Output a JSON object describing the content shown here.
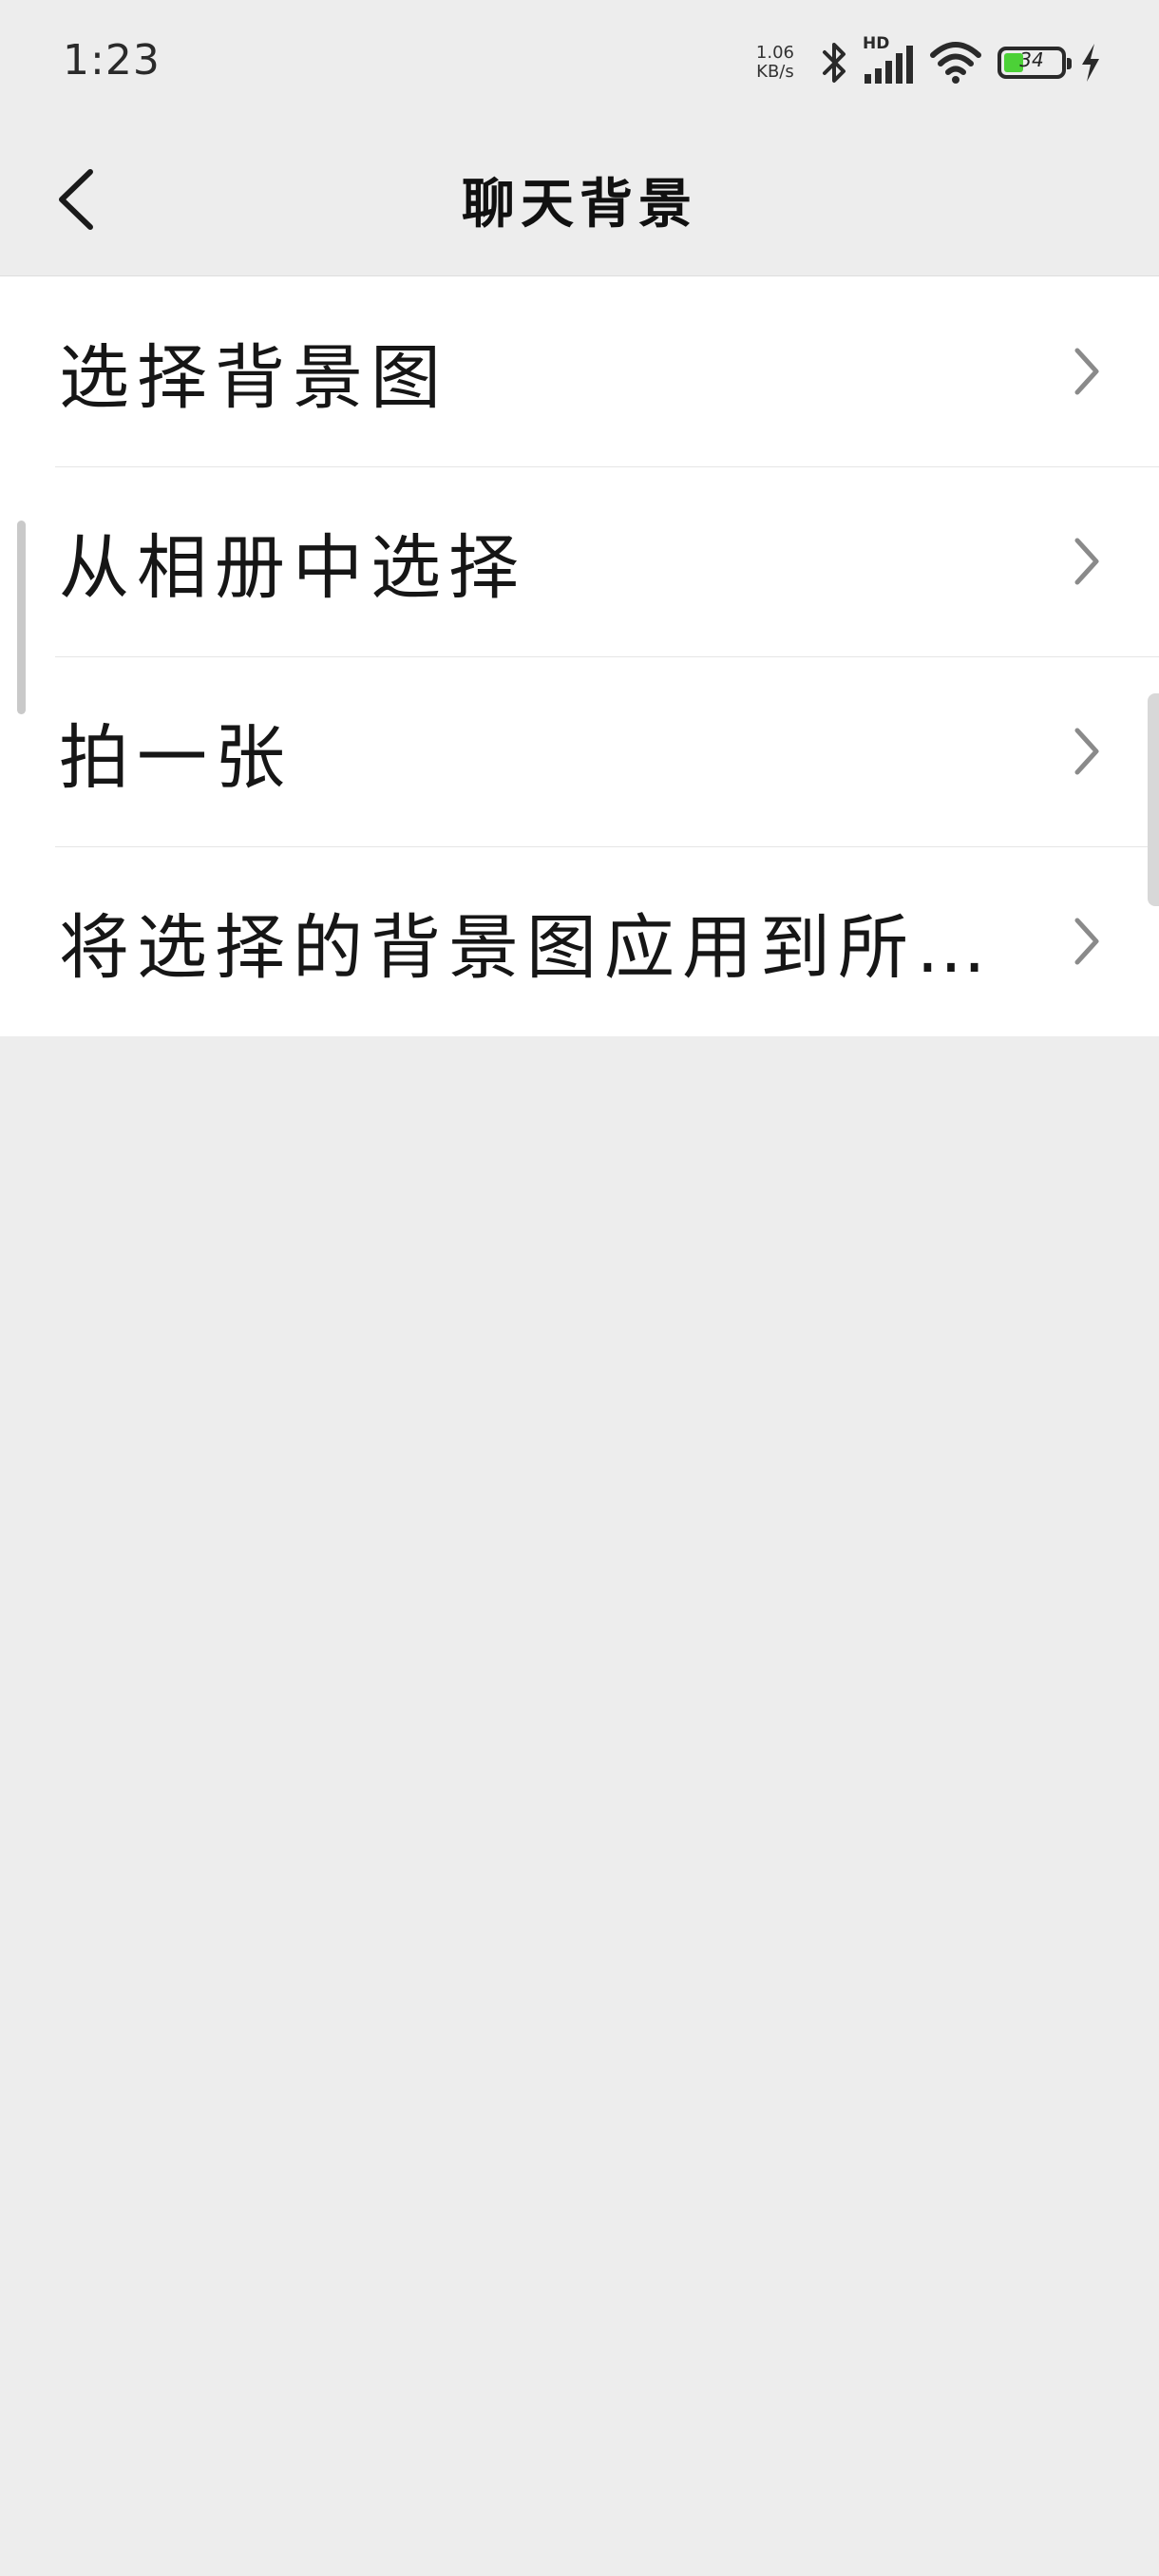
{
  "status_bar": {
    "time": "1:23",
    "net_speed_value": "1.06",
    "net_speed_unit": "KB/s",
    "network_label": "HD",
    "battery_level": "34",
    "battery_fraction": 0.34,
    "battery_color": "#4cd137",
    "icons": [
      "bluetooth-icon",
      "signal-icon",
      "wifi-icon",
      "battery-icon",
      "charging-icon"
    ]
  },
  "header": {
    "title": "聊天背景",
    "back_icon": "back-arrow-icon"
  },
  "menu": {
    "items": [
      {
        "label": "选择背景图"
      },
      {
        "label": "从相册中选择"
      },
      {
        "label": "拍一张"
      },
      {
        "label": "将选择的背景图应用到所有聊天场景"
      }
    ],
    "item_icon": "chevron-right-icon"
  }
}
